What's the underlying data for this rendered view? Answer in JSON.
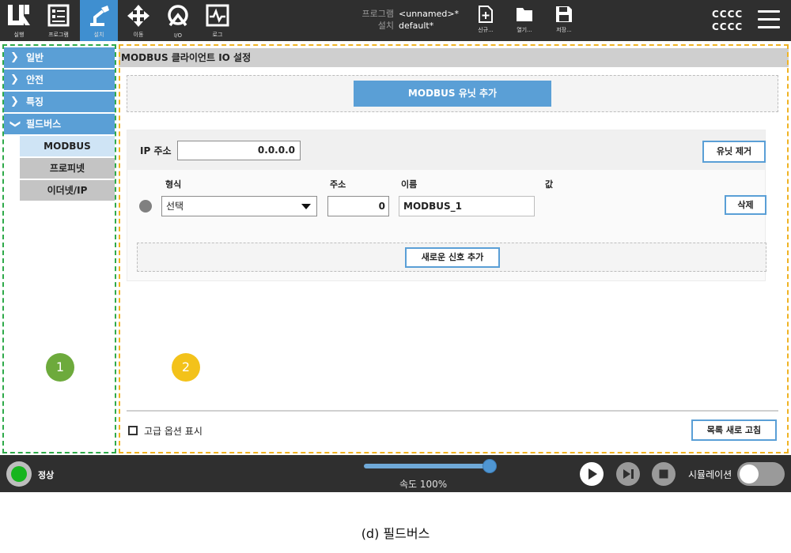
{
  "nav": {
    "items": [
      {
        "label": "실행",
        "icon": "ur-logo-icon",
        "active": false
      },
      {
        "label": "프로그램",
        "icon": "program-icon",
        "active": false
      },
      {
        "label": "설치",
        "icon": "robot-arm-icon",
        "active": true
      },
      {
        "label": "이동",
        "icon": "move-arrows-icon",
        "active": false
      },
      {
        "label": "I/O",
        "icon": "io-icon",
        "active": false
      },
      {
        "label": "로그",
        "icon": "log-icon",
        "active": false
      }
    ]
  },
  "program_info": {
    "program_key": "프로그램",
    "program_value": "<unnamed>*",
    "install_key": "설치",
    "install_value": "default*"
  },
  "file_buttons": {
    "new": "신규...",
    "open": "열기...",
    "save": "저장..."
  },
  "user": {
    "line1": "CCCC",
    "line2": "CCCC"
  },
  "sidebar": {
    "groups": [
      {
        "label": "일반",
        "expanded": false
      },
      {
        "label": "안전",
        "expanded": false
      },
      {
        "label": "특징",
        "expanded": false
      },
      {
        "label": "필드버스",
        "expanded": true
      }
    ],
    "subitems": [
      {
        "label": "MODBUS",
        "selected": true
      },
      {
        "label": "프로피넷",
        "selected": false
      },
      {
        "label": "이더넷/IP",
        "selected": false
      }
    ]
  },
  "badges": {
    "left": "1",
    "right": "2"
  },
  "main": {
    "title": "MODBUS 클라이언트 IO 설정",
    "add_unit_button": "MODBUS 유닛 추가",
    "ip_label": "IP 주소",
    "ip_value": "0.0.0.0",
    "remove_unit_button": "유닛 제거",
    "columns": {
      "type": "형식",
      "address": "주소",
      "name": "이름",
      "value": "값"
    },
    "signal": {
      "type_selected": "선택",
      "address": "0",
      "name": "MODBUS_1",
      "delete_button": "삭제"
    },
    "add_signal_button": "새로운 신호 추가",
    "advanced_checkbox_label": "고급 옵션 표시",
    "advanced_checked": false,
    "refresh_button": "목록 새로 고침"
  },
  "footer": {
    "status": "정상",
    "speed_label": "속도 100%",
    "speed_percent": 100,
    "simulation_label": "시뮬레이션",
    "simulation_on": false
  },
  "caption": "(d) 필드버스",
  "colors": {
    "accent": "#5a9fd6",
    "topbar": "#2f2f2f",
    "status_ok": "#17b51f",
    "frame_1": "#2faa4a",
    "frame_2": "#f0b323"
  }
}
